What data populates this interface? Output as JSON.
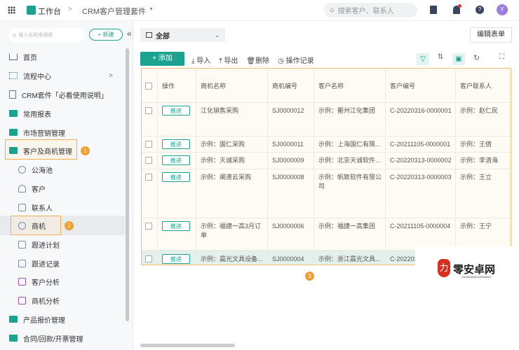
{
  "header": {
    "workspace": "工作台",
    "breadcrumb_sep": ">",
    "app_name": "CRM客户管理套件",
    "search_placeholder": "搜索客户、联系人",
    "avatar": "Y"
  },
  "sidebar": {
    "search_placeholder": "输入名称来搜索",
    "new_label": "+ 新建",
    "collapse": "«",
    "items": [
      {
        "label": "首页"
      },
      {
        "label": "流程中心"
      },
      {
        "label": "CRM套件「必看使用说明」"
      },
      {
        "label": "常用报表"
      },
      {
        "label": "市场营销管理"
      },
      {
        "label": "客户及商机管理",
        "badge": "1"
      },
      {
        "label": "公海池"
      },
      {
        "label": "客户"
      },
      {
        "label": "联系人"
      },
      {
        "label": "商机",
        "badge": "2"
      },
      {
        "label": "跟进计划"
      },
      {
        "label": "跟进记录"
      },
      {
        "label": "客户分析"
      },
      {
        "label": "商机分析"
      },
      {
        "label": "产品报价管理"
      },
      {
        "label": "合同/回款/开票管理"
      }
    ]
  },
  "view": {
    "selected": "全部",
    "edit_form": "编辑表单"
  },
  "toolbar": {
    "add": "+ 添加",
    "import": "导入",
    "export": "导出",
    "delete": "删除",
    "log": "操作记录"
  },
  "table": {
    "columns": [
      "操作",
      "商机名称",
      "商机编号",
      "客户名称",
      "客户编号",
      "客户联系人"
    ],
    "action_label": "推进",
    "rows": [
      [
        "江化销售采购",
        "SJ0000012",
        "示例：衢州江化集团",
        "C-20220316-0000001",
        "示例：赵仁民"
      ],
      [
        "示例：国仁采购",
        "SJ0000011",
        "示例：上海国仁有限...",
        "C-20211105-0000001",
        "示例：王倩"
      ],
      [
        "示例：天诚采购",
        "SJ0000009",
        "示例：北京天诚软件...",
        "C-20220313-0000002",
        "示例：李清海"
      ],
      [
        "示例：阑速云采购",
        "SJ0000008",
        "示例：帆致软件有限公司",
        "C-20220313-0000003",
        "示例：王立"
      ],
      [
        "示例：福捷一高3月订单",
        "SJ0000006",
        "示例：福捷一高集团",
        "C-20211105-0000004",
        "示例：王宁"
      ],
      [
        "示例：晨光文具设备...",
        "SJ0000004",
        "示例：浙江晨光文具...",
        "C-202203",
        ""
      ]
    ]
  },
  "annotation_3": "3",
  "watermark": {
    "text": "零安卓网",
    "sub": "XILINGANZHUOWANG"
  }
}
